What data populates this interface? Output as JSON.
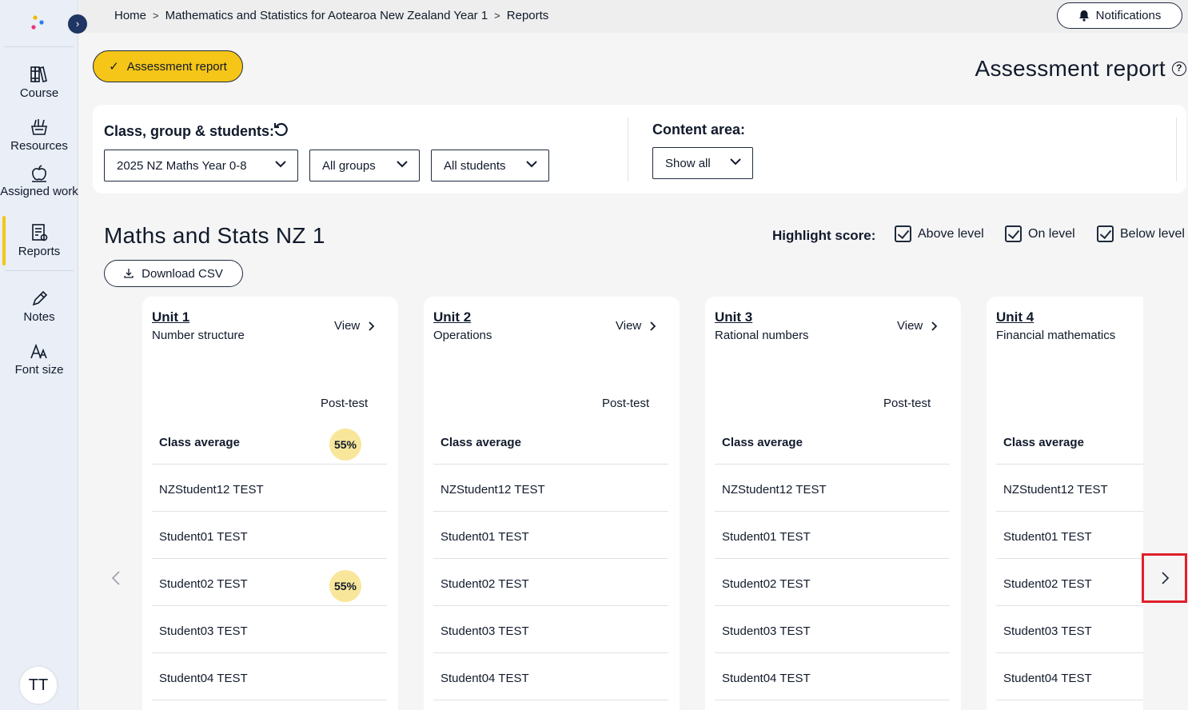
{
  "breadcrumb": [
    "Home",
    "Mathematics and Statistics for Aotearoa New Zealand Year 1",
    "Reports"
  ],
  "header": {
    "notifications_label": "Notifications"
  },
  "sidebar": {
    "items": [
      {
        "label": "Course",
        "icon": "books-icon"
      },
      {
        "label": "Resources",
        "icon": "basket-icon"
      },
      {
        "label": "Assigned work",
        "icon": "apple-icon"
      },
      {
        "label": "Reports",
        "icon": "report-icon",
        "active": true
      },
      {
        "label": "Notes",
        "icon": "pencil-icon"
      },
      {
        "label": "Font size",
        "icon": "font-size-icon"
      }
    ],
    "avatar_initials": "TT"
  },
  "report_pill_label": "Assessment report",
  "page_title": "Assessment report",
  "filters": {
    "class_label": "Class, group & students:",
    "class_value": "2025 NZ Maths Year 0-8",
    "group_value": "All groups",
    "students_value": "All students",
    "content_label": "Content area:",
    "content_value": "Show all"
  },
  "section_title": "Maths and Stats NZ 1",
  "highlight": {
    "label": "Highlight score:",
    "options": [
      "Above level",
      "On level",
      "Below level"
    ]
  },
  "download_csv_label": "Download CSV",
  "units": [
    {
      "title": "Unit 1",
      "subtitle": "Number structure",
      "view": "View",
      "column": "Post-test",
      "rows": [
        {
          "name": "Class average",
          "score": "55%"
        },
        {
          "name": "NZStudent12 TEST",
          "score": ""
        },
        {
          "name": "Student01 TEST",
          "score": ""
        },
        {
          "name": "Student02 TEST",
          "score": "55%"
        },
        {
          "name": "Student03 TEST",
          "score": ""
        },
        {
          "name": "Student04 TEST",
          "score": ""
        }
      ]
    },
    {
      "title": "Unit 2",
      "subtitle": "Operations",
      "view": "View",
      "column": "Post-test",
      "rows": [
        {
          "name": "Class average",
          "score": ""
        },
        {
          "name": "NZStudent12 TEST",
          "score": ""
        },
        {
          "name": "Student01 TEST",
          "score": ""
        },
        {
          "name": "Student02 TEST",
          "score": ""
        },
        {
          "name": "Student03 TEST",
          "score": ""
        },
        {
          "name": "Student04 TEST",
          "score": ""
        }
      ]
    },
    {
      "title": "Unit 3",
      "subtitle": "Rational numbers",
      "view": "View",
      "column": "Post-test",
      "rows": [
        {
          "name": "Class average",
          "score": ""
        },
        {
          "name": "NZStudent12 TEST",
          "score": ""
        },
        {
          "name": "Student01 TEST",
          "score": ""
        },
        {
          "name": "Student02 TEST",
          "score": ""
        },
        {
          "name": "Student03 TEST",
          "score": ""
        },
        {
          "name": "Student04 TEST",
          "score": ""
        }
      ]
    },
    {
      "title": "Unit 4",
      "subtitle": "Financial mathematics",
      "view": "",
      "column": "",
      "rows": [
        {
          "name": "Class average",
          "score": ""
        },
        {
          "name": "NZStudent12 TEST",
          "score": ""
        },
        {
          "name": "Student01 TEST",
          "score": ""
        },
        {
          "name": "Student02 TEST",
          "score": ""
        },
        {
          "name": "Student03 TEST",
          "score": ""
        },
        {
          "name": "Student04 TEST",
          "score": ""
        }
      ]
    }
  ],
  "colors": {
    "accent": "#f5c518",
    "navy": "#1f3563",
    "badge": "#f8e69a",
    "highlight_box": "#e0202a"
  }
}
